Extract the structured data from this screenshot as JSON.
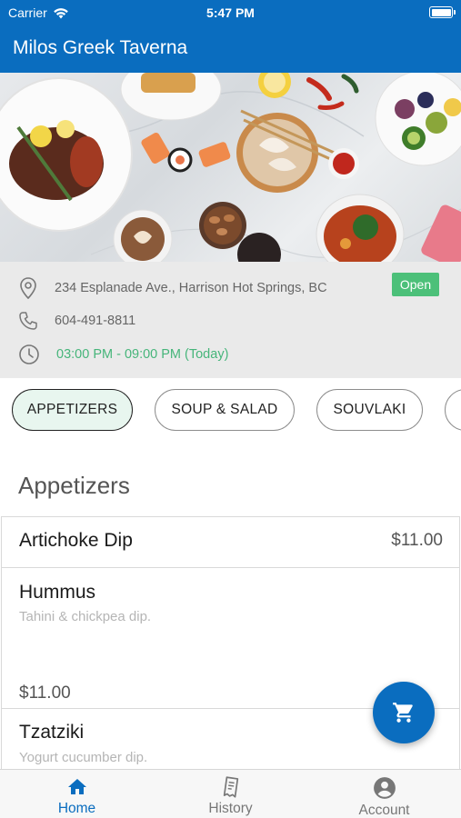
{
  "status_bar": {
    "carrier": "Carrier",
    "time": "5:47 PM"
  },
  "header": {
    "title": "Milos Greek Taverna"
  },
  "info": {
    "address": "234 Esplanade Ave., Harrison Hot Springs, BC",
    "phone": "604-491-8811",
    "hours": "03:00 PM - 09:00 PM (Today)",
    "status": "Open"
  },
  "categories": [
    {
      "label": "APPETIZERS",
      "active": true
    },
    {
      "label": "SOUP & SALAD",
      "active": false
    },
    {
      "label": "SOUVLAKI",
      "active": false
    }
  ],
  "section": {
    "title": "Appetizers"
  },
  "items": [
    {
      "name": "Artichoke Dip",
      "description": "",
      "price": "$11.00"
    },
    {
      "name": "Hummus",
      "description": "Tahini & chickpea dip.",
      "price": "$11.00"
    },
    {
      "name": "Tzatziki",
      "description": "Yogurt cucumber dip.",
      "price": ""
    }
  ],
  "nav": [
    {
      "label": "Home",
      "icon": "home-icon",
      "active": true
    },
    {
      "label": "History",
      "icon": "receipt-icon",
      "active": false
    },
    {
      "label": "Account",
      "icon": "account-icon",
      "active": false
    }
  ],
  "colors": {
    "primary": "#0a6dbf",
    "open_badge": "#4cc079",
    "hours_text": "#46b57a",
    "chip_active_bg": "#e8f6ef"
  }
}
